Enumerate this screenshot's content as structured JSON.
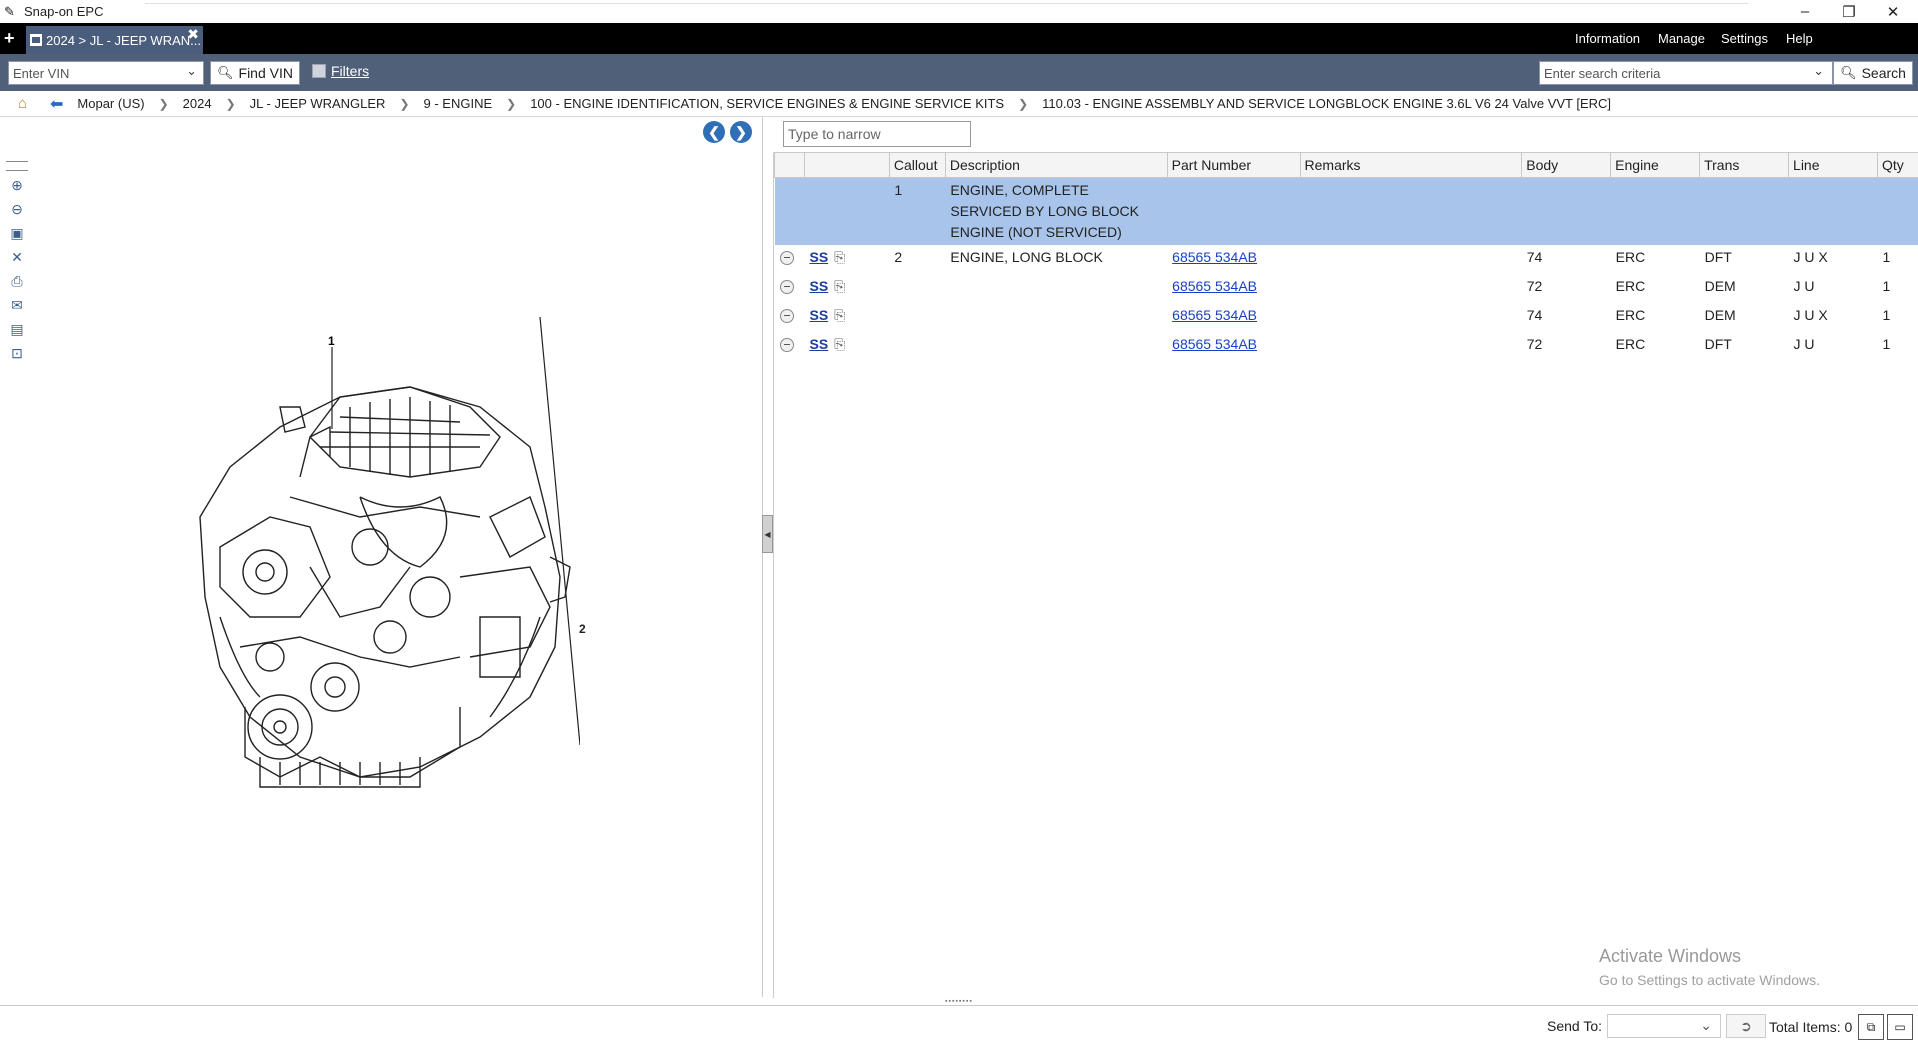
{
  "window": {
    "title": "Snap-on EPC",
    "minimize": "–",
    "restore": "❐",
    "close": "✕"
  },
  "tab": {
    "new": "+",
    "label": "2024 > JL - JEEP WRAN...",
    "close": "✖"
  },
  "menu": [
    "Information",
    "Manage",
    "Settings",
    "Help"
  ],
  "toolbar": {
    "vin_placeholder": "Enter VIN",
    "find_vin": "Find VIN",
    "filters": "Filters",
    "search_placeholder": "Enter search criteria",
    "search": "Search"
  },
  "breadcrumb": [
    "Mopar (US)",
    "2024",
    "JL - JEEP WRANGLER",
    "9 - ENGINE",
    "100 - ENGINE IDENTIFICATION, SERVICE ENGINES & ENGINE SERVICE KITS",
    "110.03 - ENGINE ASSEMBLY AND SERVICE LONGBLOCK ENGINE 3.6L V6 24 Valve VVT [ERC]"
  ],
  "illustration": {
    "callouts": [
      "1",
      "2"
    ]
  },
  "narrow": {
    "placeholder": "Type to narrow"
  },
  "grid": {
    "headers": [
      "",
      "",
      "Callout",
      "Description",
      "Part Number",
      "Remarks",
      "Body",
      "Engine",
      "Trans",
      "Line",
      "Qty"
    ],
    "header_row": {
      "callout": "1",
      "description": "ENGINE, COMPLETE  SERVICED BY LONG BLOCK ENGINE (NOT SERVICED)"
    },
    "rows": [
      {
        "ss": "SS",
        "callout": "2",
        "description": "ENGINE, LONG BLOCK",
        "part": "68565 534AB",
        "remarks": "",
        "body": "74",
        "engine": "ERC",
        "trans": "DFT",
        "line": "J U X",
        "qty": "1"
      },
      {
        "ss": "SS",
        "callout": "",
        "description": "",
        "part": "68565 534AB",
        "remarks": "",
        "body": "72",
        "engine": "ERC",
        "trans": "DEM",
        "line": "J U",
        "qty": "1"
      },
      {
        "ss": "SS",
        "callout": "",
        "description": "",
        "part": "68565 534AB",
        "remarks": "",
        "body": "74",
        "engine": "ERC",
        "trans": "DEM",
        "line": "J U X",
        "qty": "1"
      },
      {
        "ss": "SS",
        "callout": "",
        "description": "",
        "part": "68565 534AB",
        "remarks": "",
        "body": "72",
        "engine": "ERC",
        "trans": "DFT",
        "line": "J U",
        "qty": "1"
      }
    ]
  },
  "watermark": {
    "line1": "Activate Windows",
    "line2": "Go to Settings to activate Windows."
  },
  "status": {
    "send_to": "Send To:",
    "total": "Total Items: 0"
  }
}
